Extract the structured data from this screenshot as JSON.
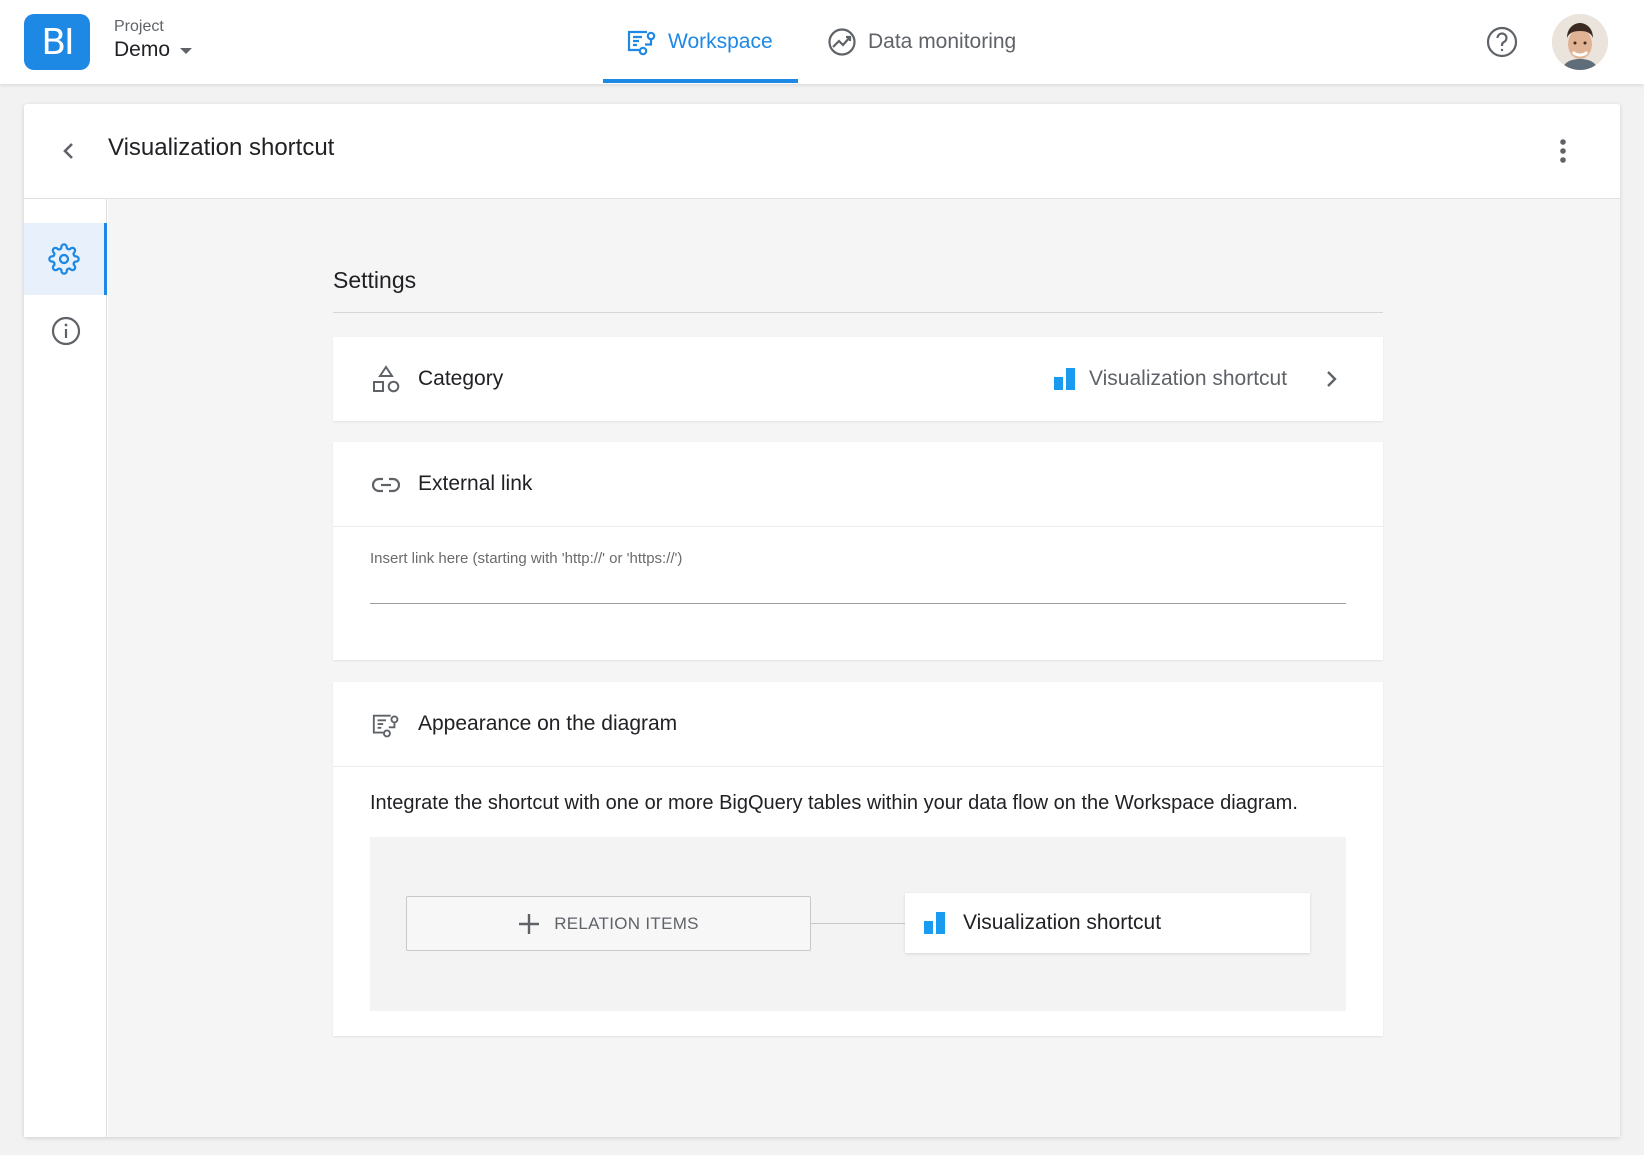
{
  "app": {
    "logo_text": "BI",
    "project_label": "Project",
    "project_name": "Demo"
  },
  "nav": {
    "tabs": [
      {
        "label": "Workspace",
        "active": true,
        "icon": "workspace-diagram-icon"
      },
      {
        "label": "Data monitoring",
        "active": false,
        "icon": "monitoring-icon"
      }
    ]
  },
  "header": {
    "title": "Visualization shortcut"
  },
  "sidebar": {
    "items": [
      {
        "name": "settings",
        "icon": "gear-icon",
        "active": true
      },
      {
        "name": "info",
        "icon": "info-icon",
        "active": false
      }
    ]
  },
  "settings": {
    "title": "Settings",
    "category": {
      "label": "Category",
      "value": "Visualization shortcut",
      "icon": "shapes-icon"
    },
    "external_link": {
      "label": "External link",
      "placeholder": "Insert link here (starting with 'http://' or 'https://')",
      "value": "",
      "icon": "link-icon"
    },
    "appearance": {
      "label": "Appearance on the diagram",
      "description": "Integrate the shortcut with one or more BigQuery tables within your data flow on the Workspace diagram.",
      "relation_button": "RELATION ITEMS",
      "node_label": "Visualization shortcut",
      "icon": "diagram-icon"
    }
  },
  "colors": {
    "accent": "#1e88e5",
    "chart_icon": "#1a9bf0"
  }
}
